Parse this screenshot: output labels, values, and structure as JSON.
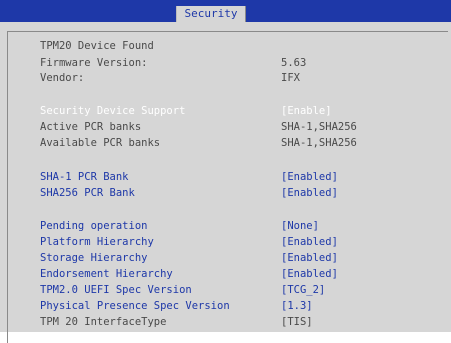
{
  "tabs": {
    "active": "Security"
  },
  "device": {
    "found": "TPM20 Device Found",
    "firmware_label": "Firmware Version:",
    "firmware_value": "5.63",
    "vendor_label": "Vendor:",
    "vendor_value": "IFX"
  },
  "support": {
    "label": "Security Device Support",
    "value": "[Enable]",
    "active_pcr_label": "Active PCR banks",
    "active_pcr_value": "SHA-1,SHA256",
    "available_pcr_label": "Available PCR banks",
    "available_pcr_value": "SHA-1,SHA256"
  },
  "banks": [
    {
      "label": "SHA-1 PCR Bank",
      "value": "[Enabled]"
    },
    {
      "label": "SHA256 PCR Bank",
      "value": "[Enabled]"
    }
  ],
  "settings": [
    {
      "label": "Pending operation",
      "value": "[None]"
    },
    {
      "label": "Platform Hierarchy",
      "value": "[Enabled]"
    },
    {
      "label": "Storage Hierarchy",
      "value": "[Enabled]"
    },
    {
      "label": "Endorsement Hierarchy",
      "value": "[Enabled]"
    },
    {
      "label": "TPM2.0 UEFI Spec Version",
      "value": "[TCG_2]"
    },
    {
      "label": "Physical Presence Spec Version",
      "value": "[1.3]"
    },
    {
      "label": "TPM 20 InterfaceType",
      "value": "[TIS]"
    }
  ],
  "colors": {
    "header": "#1e38a8",
    "panel": "#d6d6d6",
    "static_text": "#4a4a4a",
    "option_text": "#1e38a8",
    "selected_text": "#ffffff"
  }
}
